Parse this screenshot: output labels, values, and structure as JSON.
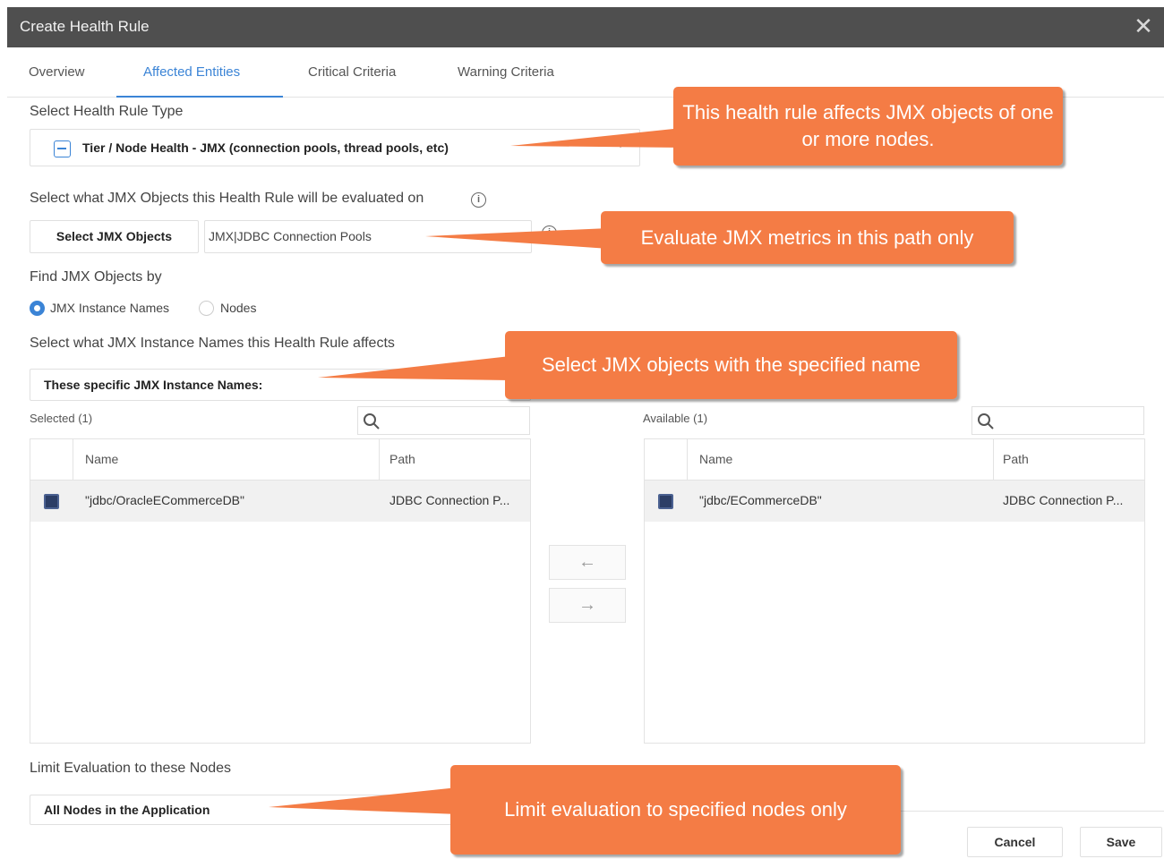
{
  "dialog": {
    "title": "Create Health Rule",
    "close_icon": "close-icon"
  },
  "tabs": [
    {
      "label": "Overview",
      "active": false
    },
    {
      "label": "Affected Entities",
      "active": true
    },
    {
      "label": "Critical Criteria",
      "active": false
    },
    {
      "label": "Warning Criteria",
      "active": false
    }
  ],
  "rule_type": {
    "label": "Select Health Rule Type",
    "value": "Tier / Node Health - JMX (connection pools, thread pools, etc)"
  },
  "jmx_objects": {
    "label": "Select what JMX Objects this Health Rule will be evaluated on",
    "button_label": "Select JMX Objects",
    "path_value": "JMX|JDBC Connection Pools"
  },
  "find_by": {
    "label": "Find JMX Objects by",
    "options": [
      {
        "label": "JMX Instance Names",
        "selected": true
      },
      {
        "label": "Nodes",
        "selected": false
      }
    ]
  },
  "instance_names": {
    "label": "Select what JMX Instance Names this Health Rule affects",
    "value": "These specific JMX Instance Names:"
  },
  "selected_list": {
    "label": "Selected (1)",
    "columns": [
      "Name",
      "Path"
    ],
    "rows": [
      {
        "name": "\"jdbc/OracleECommerceDB\"",
        "path": "JDBC Connection P..."
      }
    ]
  },
  "available_list": {
    "label": "Available (1)",
    "columns": [
      "Name",
      "Path"
    ],
    "rows": [
      {
        "name": "\"jdbc/ECommerceDB\"",
        "path": "JDBC Connection P..."
      }
    ]
  },
  "transfer": {
    "left_arrow": "←",
    "right_arrow": "→"
  },
  "limit_nodes": {
    "label": "Limit Evaluation to these Nodes",
    "value": "All Nodes in the Application"
  },
  "footer": {
    "cancel_label": "Cancel",
    "save_label": "Save"
  },
  "callouts": {
    "rule_type": "This health rule affects JMX objects of one or more nodes.",
    "path": "Evaluate JMX metrics in this path only",
    "names": "Select JMX objects with the specified name",
    "nodes": "Limit evaluation to specified nodes only"
  },
  "colors": {
    "accent": "#3b84d6",
    "title_bar": "#4f4f4f",
    "callout": "#f47c45"
  }
}
